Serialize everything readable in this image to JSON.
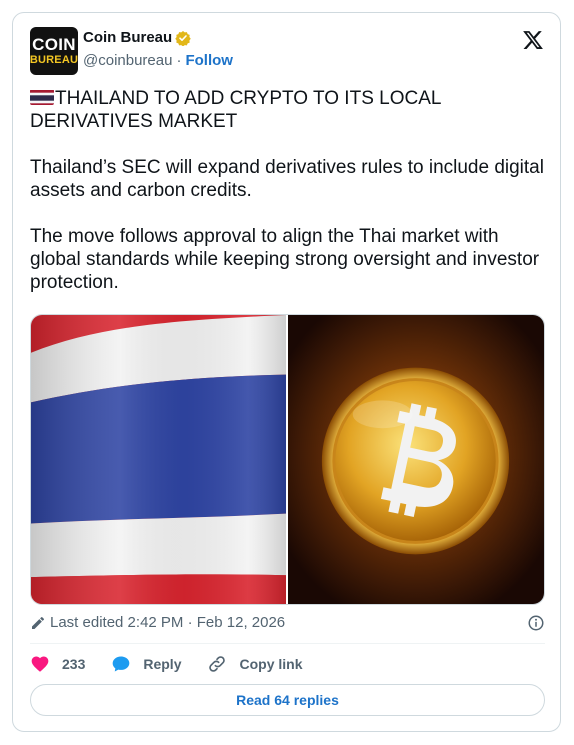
{
  "author": {
    "avatar_line1": "COIN",
    "avatar_line2": "BUREAU",
    "name": "Coin Bureau",
    "handle": "@coinbureau",
    "separator": "·",
    "follow_label": "Follow"
  },
  "tweet": {
    "headline": "THAILAND TO ADD CRYPTO TO ITS LOCAL DERIVATIVES MARKET",
    "para1": "Thailand’s SEC will expand derivatives rules to include digital assets and carbon credits.",
    "para2": "The move follows approval to align the Thai market with global standards while keeping strong oversight and investor protection."
  },
  "meta": {
    "edited_text": "Last edited 2:42 PM · Feb 12, 2026"
  },
  "actions": {
    "like_count": "233",
    "reply_label": "Reply",
    "copy_link_label": "Copy link"
  },
  "read_replies_label": "Read 64 replies",
  "colors": {
    "link_blue": "#1d73c9",
    "like_pink": "#f91880",
    "reply_blue": "#1d9bf0",
    "verified_gold": "#e2b719"
  }
}
